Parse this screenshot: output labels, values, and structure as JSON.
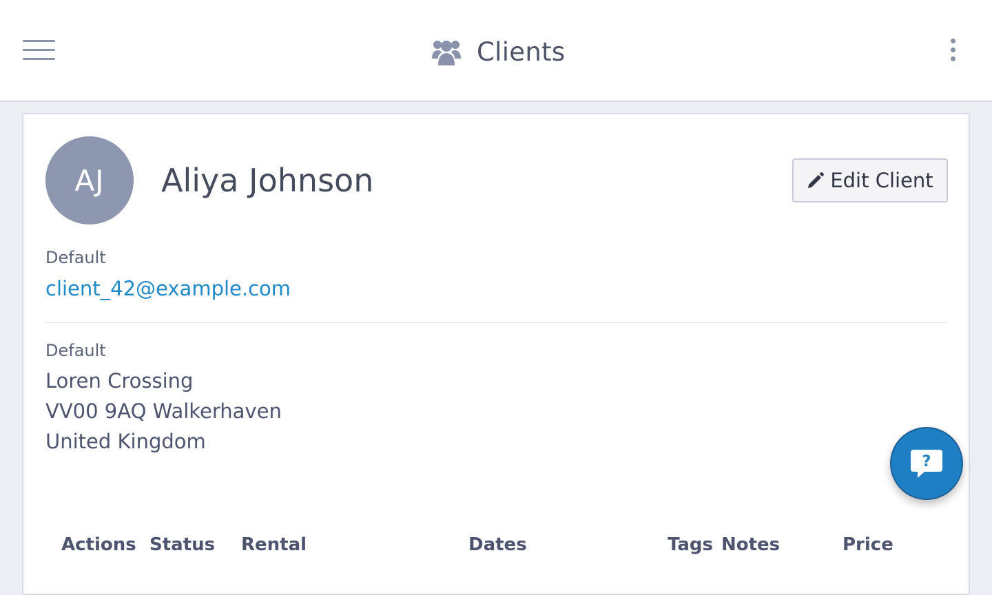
{
  "header": {
    "title": "Clients",
    "title_icon": "users-icon",
    "menu_icon": "hamburger-menu-icon",
    "more_icon": "more-vertical-icon"
  },
  "client": {
    "initials": "AJ",
    "name": "Aliya Johnson",
    "edit_label": "Edit Client",
    "edit_icon": "pencil-icon",
    "email_type": "Default",
    "email": "client_42@example.com",
    "address_type": "Default",
    "address_line1": "Loren Crossing",
    "address_line2": "VV00 9AQ Walkerhaven",
    "address_line3": "United Kingdom"
  },
  "table": {
    "columns": [
      "Actions",
      "Status",
      "Rental",
      "Dates",
      "Tags",
      "Notes",
      "Price"
    ]
  },
  "help": {
    "icon": "help-chat-icon"
  },
  "colors": {
    "accent": "#1f8ac9",
    "help_button": "#1f7fc4",
    "avatar": "#8e97b0",
    "background": "#eceef4"
  }
}
